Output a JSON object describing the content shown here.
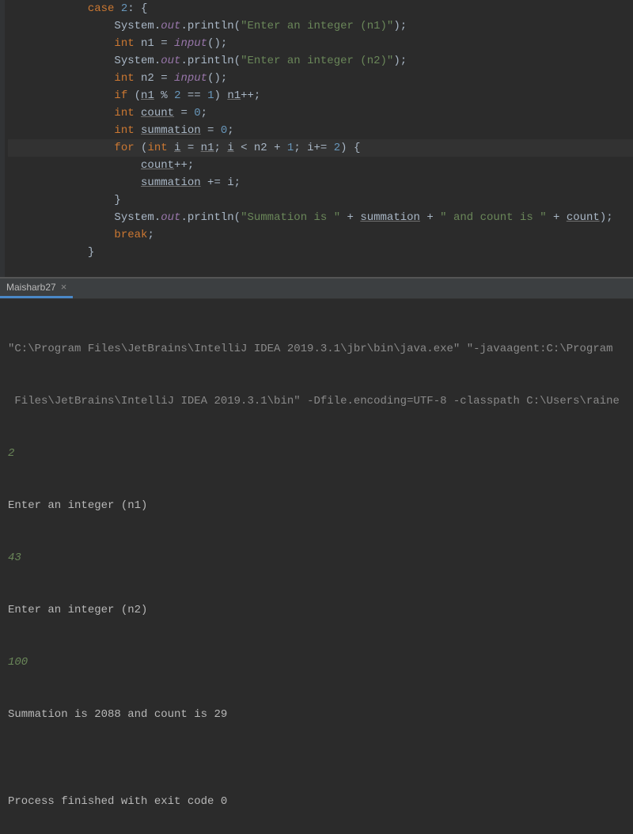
{
  "editor": {
    "lines": {
      "l0_case": "case ",
      "l0_num": "2",
      "l0_colon": ": {",
      "l1_sys": "System.",
      "l1_out": "out",
      "l1_call": ".println(",
      "l1_str": "\"Enter an integer (n1)\"",
      "l1_end": ");",
      "l2_int": "int ",
      "l2_var": "n1 = ",
      "l2_call": "input",
      "l2_end": "();",
      "l3_sys": "System.",
      "l3_out": "out",
      "l3_call": ".println(",
      "l3_str": "\"Enter an integer (n2)\"",
      "l3_end": ");",
      "l4_int": "int ",
      "l4_var": "n2 = ",
      "l4_call": "input",
      "l4_end": "();",
      "l5_if": "if ",
      "l5_open": "(",
      "l5_n1": "n1",
      "l5_mod": " % ",
      "l5_2": "2",
      "l5_eq": " == ",
      "l5_1": "1",
      "l5_close": ") ",
      "l5_n1b": "n1",
      "l5_inc": "++;",
      "l6_int": "int ",
      "l6_var": "count",
      "l6_eq": " = ",
      "l6_0": "0",
      "l6_end": ";",
      "l7_int": "int ",
      "l7_var": "summation",
      "l7_eq": " = ",
      "l7_0": "0",
      "l7_end": ";",
      "l8_for": "for ",
      "l8_open": "(",
      "l8_int": "int ",
      "l8_i": "i",
      "l8_eq": " = ",
      "l8_n1": "n1",
      "l8_semi1": "; ",
      "l8_i2": "i",
      "l8_lt": " < n2 + ",
      "l8_1": "1",
      "l8_semi2": "; i+= ",
      "l8_2": "2",
      "l8_close": ") {",
      "l9_count": "count",
      "l9_inc": "++;",
      "l10_sum": "summation",
      "l10_add": " += i;",
      "l11_brace": "}",
      "l12_sys": "System.",
      "l12_out": "out",
      "l12_call": ".println(",
      "l12_str1": "\"Summation is \"",
      "l12_plus1": " + ",
      "l12_sum": "summation",
      "l12_plus2": " + ",
      "l12_str2": "\" and count is \"",
      "l12_plus3": " + ",
      "l12_count": "count",
      "l12_end": ");",
      "l13_break": "break",
      "l13_end": ";",
      "l14_brace": "}"
    }
  },
  "tab": {
    "name": "Maisharb27",
    "close": "×"
  },
  "console": {
    "cmd1": "\"C:\\Program Files\\JetBrains\\IntelliJ IDEA 2019.3.1\\jbr\\bin\\java.exe\" \"-javaagent:C:\\Program ",
    "cmd2": " Files\\JetBrains\\IntelliJ IDEA 2019.3.1\\bin\" -Dfile.encoding=UTF-8 -classpath C:\\Users\\raine",
    "input1": "2",
    "out1": "Enter an integer (n1)",
    "input2": "43",
    "out2": "Enter an integer (n2)",
    "input3": "100",
    "out3": "Summation is 2088 and count is 29",
    "blank": "",
    "exit": "Process finished with exit code 0"
  }
}
